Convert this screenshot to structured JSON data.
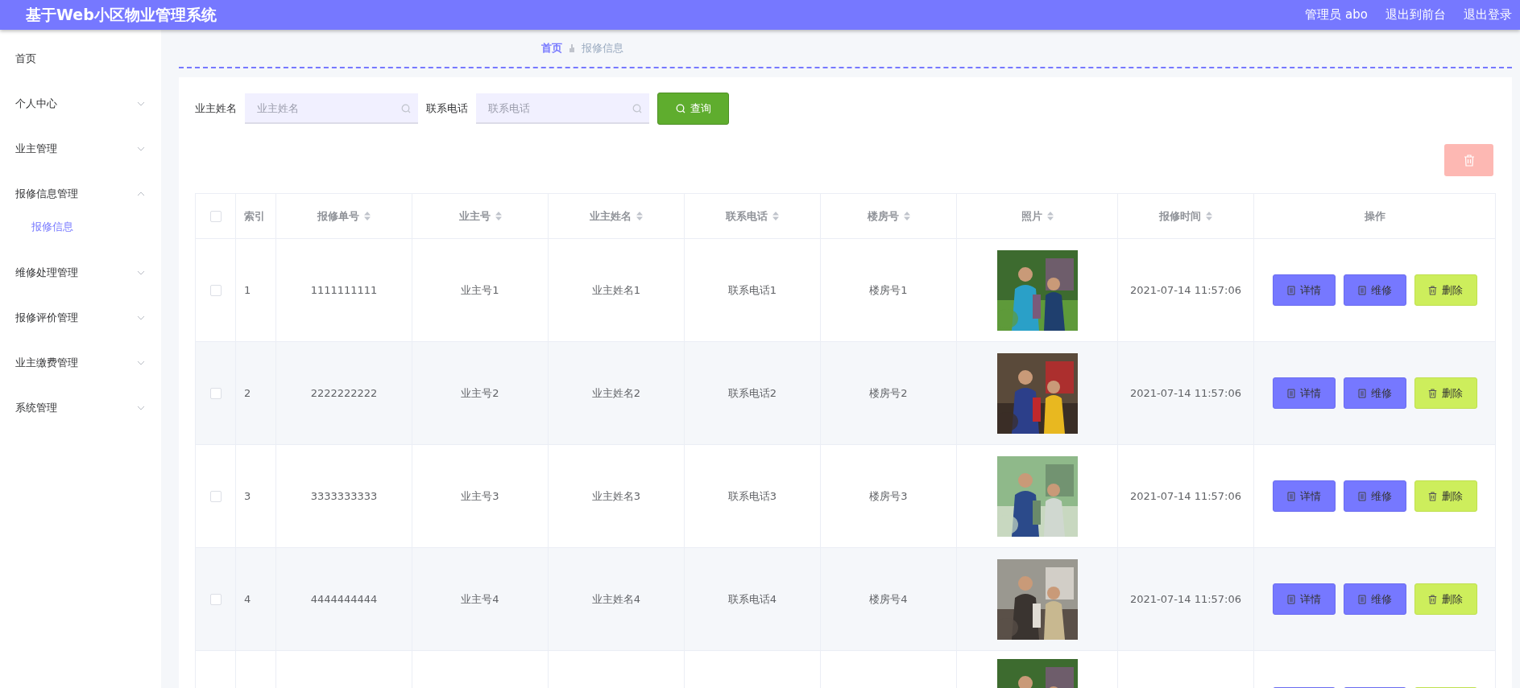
{
  "header": {
    "title": "基于Web小区物业管理系统",
    "links": [
      {
        "label": "管理员 abo"
      },
      {
        "label": "退出到前台"
      },
      {
        "label": "退出登录"
      }
    ]
  },
  "sidebar": {
    "items": [
      {
        "label": "首页",
        "kind": "link"
      },
      {
        "label": "个人中心",
        "kind": "menu",
        "expanded": false
      },
      {
        "label": "业主管理",
        "kind": "menu",
        "expanded": false
      },
      {
        "label": "报修信息管理",
        "kind": "menu",
        "expanded": true,
        "children": [
          {
            "label": "报修信息",
            "selected": true
          }
        ]
      },
      {
        "label": "维修处理管理",
        "kind": "menu",
        "expanded": false
      },
      {
        "label": "报修评价管理",
        "kind": "menu",
        "expanded": false
      },
      {
        "label": "业主缴费管理",
        "kind": "menu",
        "expanded": false
      },
      {
        "label": "系统管理",
        "kind": "menu",
        "expanded": false
      }
    ]
  },
  "breadcrumb": [
    {
      "label": "首页",
      "selected": true
    },
    {
      "label": "报修信息",
      "selected": false
    }
  ],
  "search": {
    "fields": [
      {
        "label": "业主姓名",
        "placeholder": "业主姓名"
      },
      {
        "label": "联系电话",
        "placeholder": "联系电话"
      }
    ],
    "button": "查询"
  },
  "table": {
    "all_checked": false,
    "columns": [
      {
        "label": "索引",
        "sortable": false
      },
      {
        "label": "报修单号",
        "sortable": true
      },
      {
        "label": "业主号",
        "sortable": true
      },
      {
        "label": "业主姓名",
        "sortable": true
      },
      {
        "label": "联系电话",
        "sortable": true
      },
      {
        "label": "楼房号",
        "sortable": true
      },
      {
        "label": "照片",
        "sortable": true
      },
      {
        "label": "报修时间",
        "sortable": true
      },
      {
        "label": "操作",
        "sortable": false
      }
    ],
    "rows": [
      {
        "kind": "full",
        "checked": false,
        "cells": [
          "1",
          "1111111111",
          "业主号1",
          "业主姓名1",
          "联系电话1",
          "楼房号1"
        ],
        "time": "2021-07-14 11:57:06",
        "actions": [
          "详情",
          "维修",
          "删除"
        ]
      },
      {
        "kind": "full",
        "checked": false,
        "cells": [
          "2",
          "2222222222",
          "业主号2",
          "业主姓名2",
          "联系电话2",
          "楼房号2"
        ],
        "time": "2021-07-14 11:57:06",
        "actions": [
          "详情",
          "维修",
          "删除"
        ]
      },
      {
        "kind": "full",
        "checked": false,
        "cells": [
          "3",
          "3333333333",
          "业主号3",
          "业主姓名3",
          "联系电话3",
          "楼房号3"
        ],
        "time": "2021-07-14 11:57:06",
        "actions": [
          "详情",
          "维修",
          "删除"
        ]
      },
      {
        "kind": "full",
        "checked": false,
        "cells": [
          "4",
          "4444444444",
          "业主号4",
          "业主姓名4",
          "联系电话4",
          "楼房号4"
        ],
        "time": "2021-07-14 11:57:06",
        "actions": [
          "详情",
          "维修",
          "删除"
        ]
      },
      {
        "kind": "cut_off"
      }
    ]
  }
}
